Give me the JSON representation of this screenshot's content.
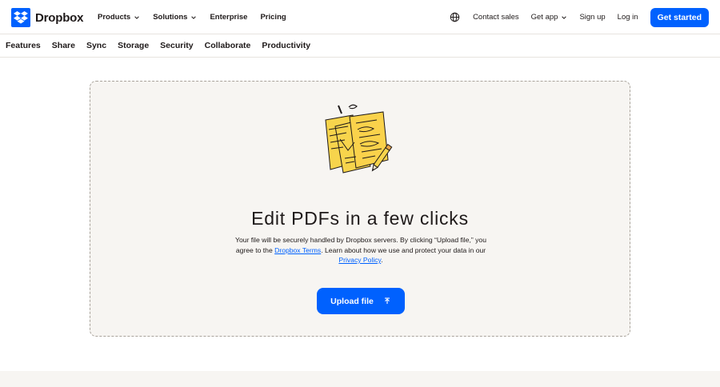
{
  "brand": {
    "name": "Dropbox",
    "accent": "#0061fe"
  },
  "topnav": {
    "left": [
      {
        "label": "Products",
        "has_dropdown": true
      },
      {
        "label": "Solutions",
        "has_dropdown": true
      },
      {
        "label": "Enterprise",
        "has_dropdown": false
      },
      {
        "label": "Pricing",
        "has_dropdown": false
      }
    ],
    "globe_icon": "globe-icon",
    "right": [
      {
        "label": "Contact sales"
      },
      {
        "label": "Get app",
        "has_dropdown": true
      },
      {
        "label": "Sign up"
      },
      {
        "label": "Log in"
      }
    ],
    "cta_label": "Get started"
  },
  "subnav": {
    "items": [
      "Features",
      "Share",
      "Sync",
      "Storage",
      "Security",
      "Collaborate",
      "Productivity"
    ]
  },
  "main": {
    "illustration": "pdf-documents-pencil-illustration",
    "headline": "Edit PDFs in a few clicks",
    "desc_part1": "Your file will be securely handled by Dropbox servers. By clicking “Upload file,” you agree to the ",
    "terms_link": "Dropbox Terms",
    "desc_part2": ". Learn about how we use and protect your data in our ",
    "privacy_link": "Privacy Policy",
    "desc_part3": ".",
    "upload_label": "Upload file",
    "upload_icon": "upload-arrow-icon"
  }
}
